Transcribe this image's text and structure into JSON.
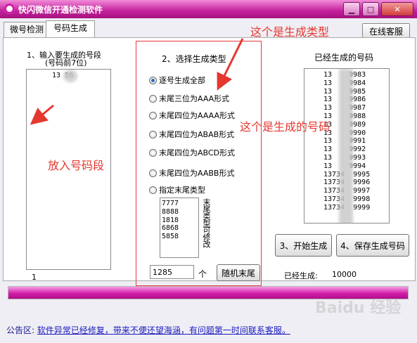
{
  "window": {
    "title": "快闪微信开通检测软件",
    "minimize": "▁",
    "maximize": "□",
    "close": "✕"
  },
  "tabs": [
    {
      "label": "微号检测"
    },
    {
      "label": "号码生成"
    }
  ],
  "service_button": "在线客服",
  "left": {
    "title_line1": "1、输入要生成的号段",
    "title_line2": "(号码前7位)",
    "segment_value": "13    56",
    "count": "1"
  },
  "middle": {
    "title": "2、选择生成类型",
    "options": [
      {
        "label": "逐号生成全部",
        "selected": true
      },
      {
        "label": "末尾三位为AAA形式",
        "selected": false
      },
      {
        "label": "末尾四位为AAAA形式",
        "selected": false
      },
      {
        "label": "末尾四位为ABAB形式",
        "selected": false
      },
      {
        "label": "末尾四位为ABCD形式",
        "selected": false
      },
      {
        "label": "末尾四位为AABB形式",
        "selected": false
      },
      {
        "label": "指定末尾类型",
        "selected": false
      }
    ],
    "tail_values": [
      "7777",
      "8888",
      "1818",
      "6868",
      "5858"
    ],
    "tail_hint": "末尾类型可修改",
    "count_value": "1285",
    "count_unit": "个",
    "random_button": "随机末尾"
  },
  "right": {
    "title": "已经生成的号码",
    "numbers": [
      "13    9983",
      "13    9984",
      "13    9985",
      "13    9986",
      "13    9987",
      "13    9988",
      "13    9989",
      "13    9990",
      "13    9991",
      "13    9992",
      "13    9993",
      "13    9994",
      "13734  9995",
      "13734  9996",
      "13734  9997",
      "13734  9998",
      "13734  9999"
    ],
    "start_button": "3、开始生成",
    "save_button": "4、保存生成号码",
    "generated_label": "已经生成:",
    "generated_count": "10000"
  },
  "progress_fraction": 1.0,
  "notice": {
    "head": "公告区:",
    "text": "软件异常已经修复，带来不便还望海涵，有问题第一时间联系客服。"
  },
  "annotations": {
    "type_label": "这个是生成类型",
    "numbers_label": "这个是生成的号码",
    "segment_label": "放入号码段"
  },
  "watermark": "Baidu 经验",
  "colors": {
    "accent": "#c2219b",
    "annotation": "#e4382f"
  }
}
